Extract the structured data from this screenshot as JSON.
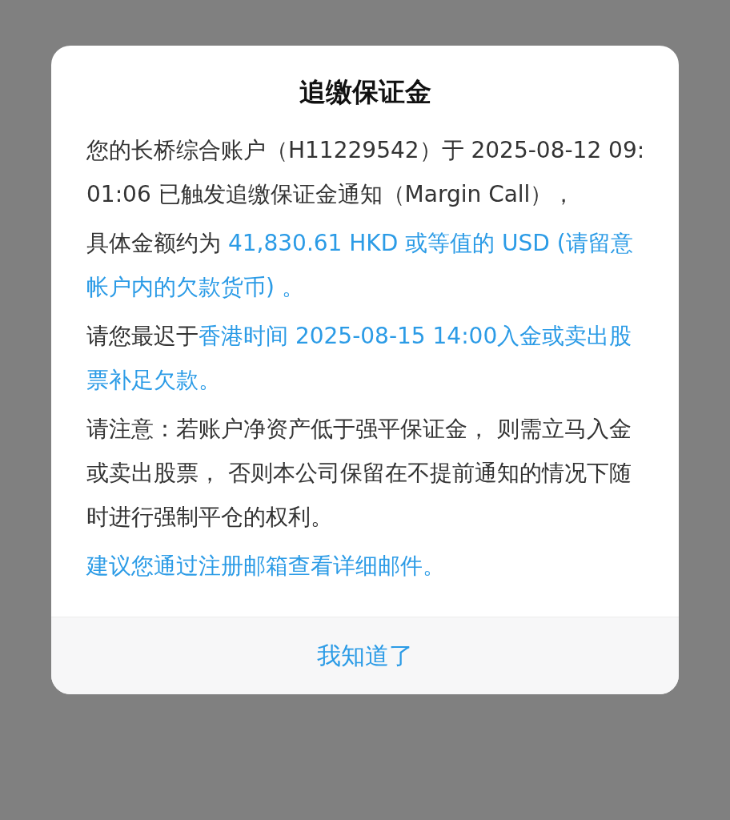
{
  "dialog": {
    "title": "追缴保证金",
    "paragraphs": [
      {
        "segments": [
          {
            "text": "您的长桥综合账户（H11229542）于 2025-08-12 09:01:06 已触发追缴保证金通知（Margin Call），",
            "highlight": false
          }
        ]
      },
      {
        "segments": [
          {
            "text": "具体金额约为 ",
            "highlight": false
          },
          {
            "text": "41,830.61 HKD 或等值的 USD (请留意帐户内的欠款货币) 。",
            "highlight": true
          }
        ]
      },
      {
        "segments": [
          {
            "text": "请您最迟于",
            "highlight": false
          },
          {
            "text": "香港时间 2025-08-15 14:00入金或卖出股票补足欠款。",
            "highlight": true
          }
        ]
      },
      {
        "segments": [
          {
            "text": "请注意：若账户净资产低于强平保证金， 则需立马入金或卖出股票， 否则本公司保留在不提前通知的情况下随时进行强制平仓的权利。",
            "highlight": false
          }
        ]
      },
      {
        "segments": [
          {
            "text": "建议您通过注册邮箱查看详细邮件。",
            "highlight": true
          }
        ]
      }
    ],
    "button": "我知道了"
  }
}
